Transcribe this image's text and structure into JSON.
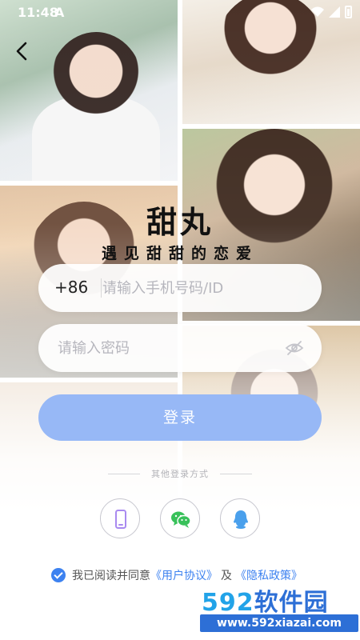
{
  "status_bar": {
    "time": "11:48",
    "notif": "A"
  },
  "app": {
    "title": "甜丸",
    "slogan": "遇见甜甜的恋爱"
  },
  "phone": {
    "country_code": "+86",
    "placeholder": "请输入手机号码/ID"
  },
  "password": {
    "placeholder": "请输入密码"
  },
  "login_button": "登录",
  "other_methods": {
    "label": "其他登录方式",
    "items": [
      {
        "icon": "phone-icon",
        "color": "#a98af0"
      },
      {
        "icon": "wechat-icon",
        "color": "#38c15a"
      },
      {
        "icon": "qq-icon",
        "color": "#4aa0ec"
      }
    ]
  },
  "agreement": {
    "prefix": "我已阅读并同意",
    "user_agreement": "《用户协议》",
    "and": "及",
    "privacy_policy": "《隐私政策》"
  },
  "watermark": {
    "brand_num": "592",
    "brand_text": "软件园",
    "url": "www.592xiazai.com"
  },
  "colors": {
    "accent": "#3d82f0",
    "login_bg": "#97b8f6"
  }
}
